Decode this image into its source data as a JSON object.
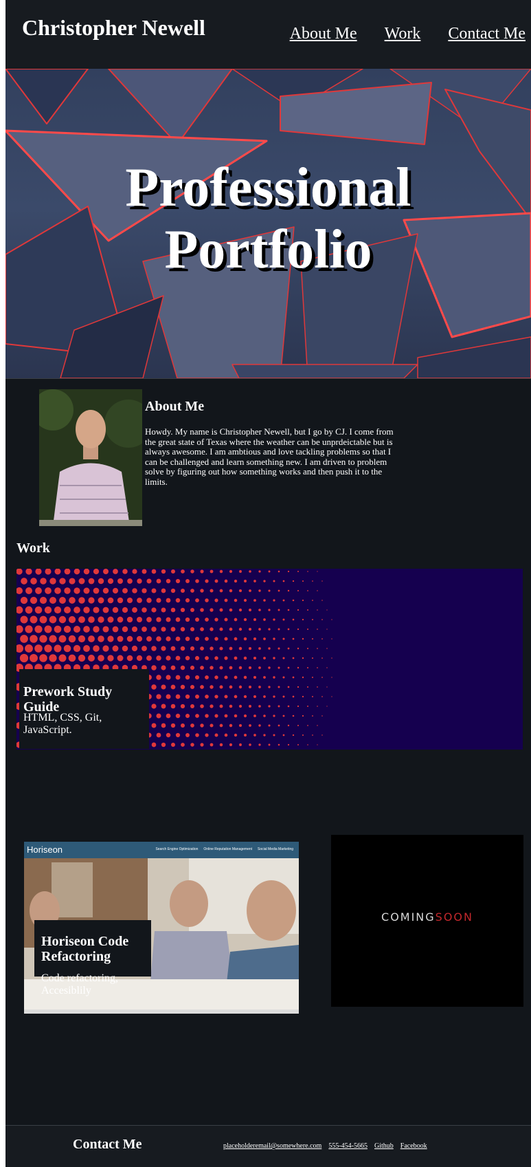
{
  "header": {
    "name": "Christopher Newell",
    "nav": [
      "About Me",
      "Work",
      "Contact Me"
    ]
  },
  "hero": {
    "title_line1": "Professional",
    "title_line2": "Portfolio"
  },
  "about": {
    "heading": "About Me",
    "text": "Howdy. My name is Christopher Newell, but I go by CJ. I come from the great state of Texas where the weather can be unprdeictable but is always awesome. I am ambtious and love tackling problems so that I can be challenged and learn something new. I am driven to problem solve by figuring out how something works and then push it to the limits."
  },
  "work": {
    "heading": "Work",
    "projects": [
      {
        "title": "Prework Study Guide",
        "description": "HTML, CSS, Git, JavaScript."
      },
      {
        "title": "Horiseon Code Refactoring",
        "description": "Code refactoring, Accesiblily",
        "screenshot": {
          "logo": "Horiseon",
          "links": [
            "Search Engine Optimization",
            "Online Reputation Management",
            "Social Media Marketing"
          ]
        }
      },
      {
        "coming": "COMING",
        "soon": "SOON"
      }
    ]
  },
  "footer": {
    "heading": "Contact Me",
    "links": [
      "placeholderemail@somewhere.com",
      "555-454-5665",
      "Github",
      "Facebook"
    ]
  },
  "colors": {
    "background": "#12161b",
    "header": "#171b20",
    "accent_red": "#e0383a",
    "card_purple": "#15004f"
  }
}
